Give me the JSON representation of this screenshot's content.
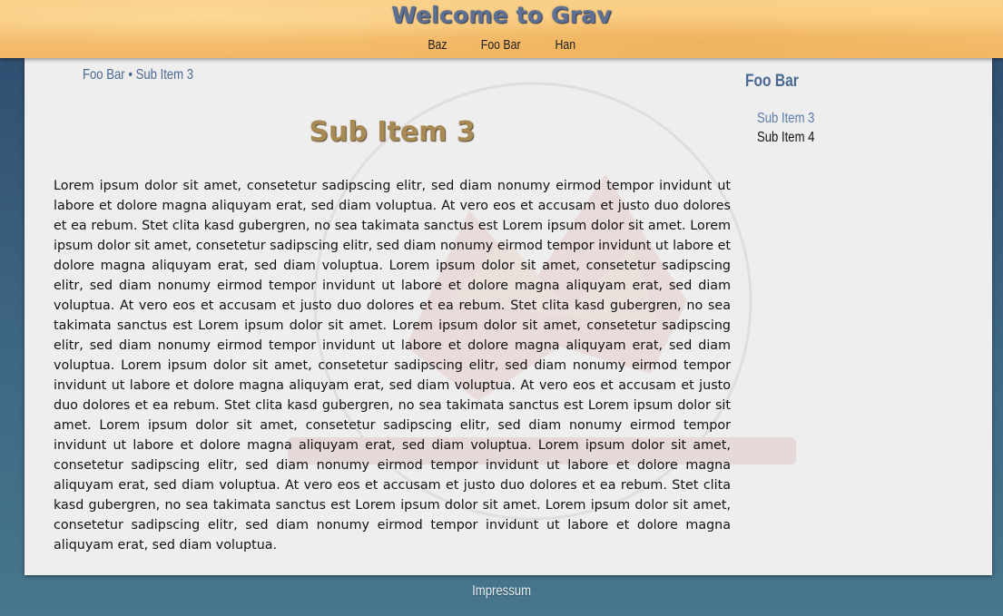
{
  "header": {
    "site_title": "Welcome to Grav",
    "nav": [
      "Baz",
      "Foo Bar",
      "Han"
    ]
  },
  "breadcrumb": {
    "parent": "Foo Bar",
    "separator": "•",
    "current": "Sub Item 3"
  },
  "page": {
    "title": "Sub Item 3",
    "body": "Lorem ipsum dolor sit amet, consetetur sadipscing elitr, sed diam nonumy eirmod tempor invidunt ut labore et dolore magna aliquyam erat, sed diam voluptua. At vero eos et accusam et justo duo dolores et ea rebum. Stet clita kasd gubergren, no sea takimata sanctus est Lorem ipsum dolor sit amet. Lorem ipsum dolor sit amet, consetetur sadipscing elitr, sed diam nonumy eirmod tempor invidunt ut labore et dolore magna aliquyam erat, sed diam voluptua. Lorem ipsum dolor sit amet, consetetur sadipscing elitr, sed diam nonumy eirmod tempor invidunt ut labore et dolore magna aliquyam erat, sed diam voluptua. At vero eos et accusam et justo duo dolores et ea rebum. Stet clita kasd gubergren, no sea takimata sanctus est Lorem ipsum dolor sit amet. Lorem ipsum dolor sit amet, consetetur sadipscing elitr, sed diam nonumy eirmod tempor invidunt ut labore et dolore magna aliquyam erat, sed diam voluptua. Lorem ipsum dolor sit amet, consetetur sadipscing elitr, sed diam nonumy eirmod tempor invidunt ut labore et dolore magna aliquyam erat, sed diam voluptua. At vero eos et accusam et justo duo dolores et ea rebum. Stet clita kasd gubergren, no sea takimata sanctus est Lorem ipsum dolor sit amet. Lorem ipsum dolor sit amet, consetetur sadipscing elitr, sed diam nonumy eirmod tempor invidunt ut labore et dolore magna aliquyam erat, sed diam voluptua. Lorem ipsum dolor sit amet, consetetur sadipscing elitr, sed diam nonumy eirmod tempor invidunt ut labore et dolore magna aliquyam erat, sed diam voluptua. At vero eos et accusam et justo duo dolores et ea rebum. Stet clita kasd gubergren, no sea takimata sanctus est Lorem ipsum dolor sit amet. Lorem ipsum dolor sit amet, consetetur sadipscing elitr, sed diam nonumy eirmod tempor invidunt ut labore et dolore magna aliquyam erat, sed diam voluptua."
  },
  "sidebar": {
    "title": "Foo Bar",
    "items": [
      {
        "label": "Sub Item 3",
        "state": "active"
      },
      {
        "label": "Sub Item 4",
        "state": "normal"
      }
    ]
  },
  "footer": {
    "link": "Impressum"
  },
  "colors": {
    "header_bg": "#f3b866",
    "site_title": "#5d6f93",
    "page_title": "#a88a54",
    "link": "#4b6890",
    "panel_bg": "#eeeeef",
    "page_bg": "#3d6683"
  }
}
